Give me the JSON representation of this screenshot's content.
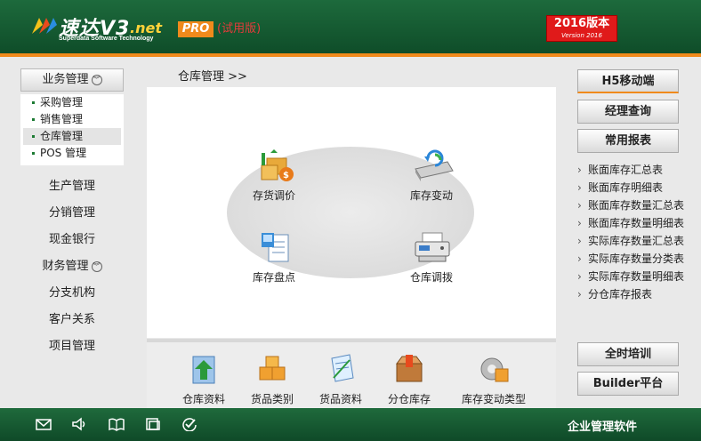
{
  "header": {
    "logo_title": "速达V3",
    "logo_net": ".net",
    "logo_sub": "Superdata Software Technology",
    "pro_badge": "PRO",
    "trial_label": "(试用版)",
    "version_main": "2016版本",
    "version_sub": "Version 2016"
  },
  "colors": {
    "header_green": "#156039",
    "accent_orange": "#f08a1c",
    "version_red": "#e01a1a"
  },
  "sidebar": {
    "head_label": "业务管理",
    "submenu": [
      {
        "label": "采购管理"
      },
      {
        "label": "销售管理"
      },
      {
        "label": "仓库管理",
        "active": true
      },
      {
        "label": "POS 管理"
      }
    ],
    "items": [
      {
        "label": "生产管理"
      },
      {
        "label": "分销管理"
      },
      {
        "label": "现金银行"
      },
      {
        "label": "财务管理",
        "expandable": true
      },
      {
        "label": "分支机构"
      },
      {
        "label": "客户关系"
      },
      {
        "label": "项目管理"
      }
    ]
  },
  "main": {
    "breadcrumb": "仓库管理  >>",
    "functions": [
      {
        "label": "存货调价",
        "icon": "price-adjust-icon"
      },
      {
        "label": "库存变动",
        "icon": "stock-change-icon"
      },
      {
        "label": "库存盘点",
        "icon": "stock-check-icon"
      },
      {
        "label": "仓库调拨",
        "icon": "transfer-icon"
      }
    ],
    "tools": [
      {
        "label": "仓库资料",
        "icon": "warehouse-icon"
      },
      {
        "label": "货品类别",
        "icon": "category-icon"
      },
      {
        "label": "货品资料",
        "icon": "goods-info-icon"
      },
      {
        "label": "分仓库存",
        "icon": "branch-stock-icon"
      },
      {
        "label": "库存变动类型",
        "icon": "change-type-icon"
      }
    ]
  },
  "right": {
    "buttons": {
      "h5": "H5移动端",
      "manager": "经理查询",
      "reports": "常用报表",
      "training": "全时培训",
      "builder": "Builder平台"
    },
    "reports": [
      "账面库存汇总表",
      "账面库存明细表",
      "账面库存数量汇总表",
      "账面库存数量明细表",
      "实际库存数量汇总表",
      "实际库存数量分类表",
      "实际库存数量明细表",
      "分仓库存报表"
    ]
  },
  "footer": {
    "text": "企业管理软件",
    "icons": [
      "mail-icon",
      "speaker-icon",
      "book-icon",
      "window-icon",
      "check-icon"
    ]
  }
}
